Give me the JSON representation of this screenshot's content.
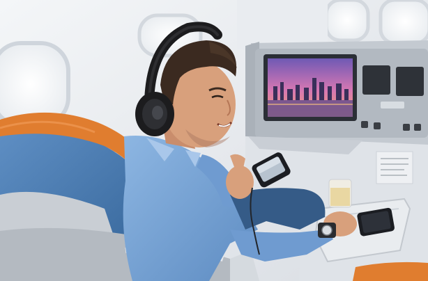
{
  "scene": {
    "description_free": true,
    "palette": {
      "cabin_wall": "#eef1f4",
      "window_glow": "#fdfdfd",
      "seat_blue": "#4f7fb5",
      "seat_orange": "#e07d2f",
      "shirt_blue": "#7da8d8",
      "skin": "#d29a78",
      "hair": "#3b2a20",
      "headphones": "#1c1c1e",
      "monitor_casing": "#b7bdc4",
      "console_gray": "#e3e6ea",
      "screen_sky_top": "#7a5ab8",
      "screen_sky_bottom": "#f07aa8",
      "phone": "#1b1d22"
    },
    "icons": [
      "headphones-icon",
      "smartphone-icon",
      "media-player-icon",
      "wristwatch-icon",
      "champagne-glass-icon"
    ]
  }
}
